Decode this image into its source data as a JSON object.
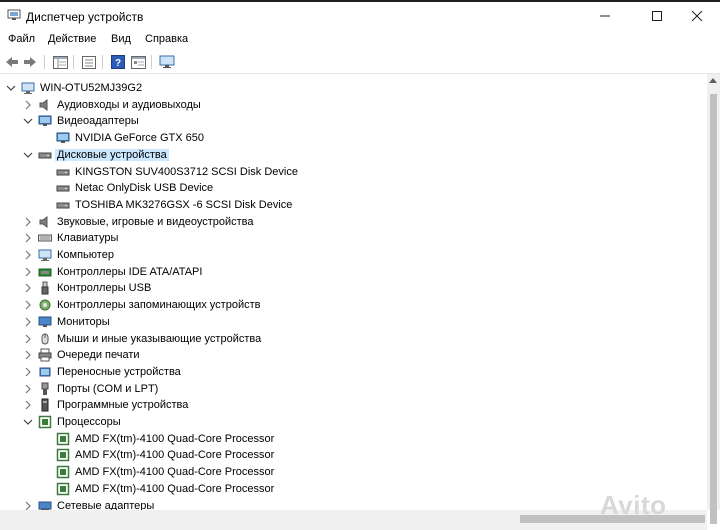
{
  "window": {
    "title": "Диспетчер устройств",
    "minimize_glyph": "—",
    "maximize_glyph": "☐",
    "close_glyph": "✕"
  },
  "menu": [
    "Файл",
    "Действие",
    "Вид",
    "Справка"
  ],
  "toolbar": {
    "buttons": [
      "back-arrow-icon",
      "forward-arrow-icon",
      "show-hide-tree-icon",
      "properties-icon",
      "help-icon",
      "action-view-icon",
      "monitor-scan-icon"
    ]
  },
  "tree": {
    "root": "WIN-OTU52MJ39G2",
    "nodes": [
      {
        "label": "Аудиовходы и аудиовыходы",
        "icon": "speaker-icon",
        "expanded": false
      },
      {
        "label": "Видеоадаптеры",
        "icon": "display-adapter-icon",
        "expanded": true
      },
      {
        "label": "NVIDIA GeForce GTX 650",
        "icon": "display-adapter-icon",
        "child": true
      },
      {
        "label": "Дисковые устройства",
        "icon": "disk-drive-icon",
        "expanded": true,
        "selected": true
      },
      {
        "label": "KINGSTON  SUV400S3712 SCSI Disk Device",
        "icon": "disk-drive-icon",
        "child": true
      },
      {
        "label": "Netac OnlyDisk USB Device",
        "icon": "disk-drive-icon",
        "child": true
      },
      {
        "label": "TOSHIBA MK3276GSX -6 SCSI Disk Device",
        "icon": "disk-drive-icon",
        "child": true
      },
      {
        "label": "Звуковые, игровые и видеоустройства",
        "icon": "speaker-icon",
        "expanded": false
      },
      {
        "label": "Клавиатуры",
        "icon": "keyboard-icon",
        "expanded": false
      },
      {
        "label": "Компьютер",
        "icon": "computer-icon",
        "expanded": false
      },
      {
        "label": "Контроллеры IDE ATA/ATAPI",
        "icon": "ide-controller-icon",
        "expanded": false
      },
      {
        "label": "Контроллеры USB",
        "icon": "usb-icon",
        "expanded": false
      },
      {
        "label": "Контроллеры запоминающих устройств",
        "icon": "storage-controller-icon",
        "expanded": false
      },
      {
        "label": "Мониторы",
        "icon": "monitor-icon",
        "expanded": false
      },
      {
        "label": "Мыши и иные указывающие устройства",
        "icon": "mouse-icon",
        "expanded": false
      },
      {
        "label": "Очереди печати",
        "icon": "printer-icon",
        "expanded": false
      },
      {
        "label": "Переносные устройства",
        "icon": "portable-device-icon",
        "expanded": false
      },
      {
        "label": "Порты (COM и LPT)",
        "icon": "port-icon",
        "expanded": false
      },
      {
        "label": "Программные устройства",
        "icon": "software-device-icon",
        "expanded": false
      },
      {
        "label": "Процессоры",
        "icon": "processor-icon",
        "expanded": true
      },
      {
        "label": "AMD FX(tm)-4100 Quad-Core Processor",
        "icon": "processor-icon",
        "child": true
      },
      {
        "label": "AMD FX(tm)-4100 Quad-Core Processor",
        "icon": "processor-icon",
        "child": true
      },
      {
        "label": "AMD FX(tm)-4100 Quad-Core Processor",
        "icon": "processor-icon",
        "child": true
      },
      {
        "label": "AMD FX(tm)-4100 Quad-Core Processor",
        "icon": "processor-icon",
        "child": true
      },
      {
        "label": "Сетевые адаптеры",
        "icon": "network-adapter-icon",
        "expanded": false
      }
    ]
  },
  "watermark": "Avito",
  "colors": {
    "selection": "#cce8ff",
    "help_blue": "#2a5cb8",
    "processor_green": "#3a7d3a"
  }
}
